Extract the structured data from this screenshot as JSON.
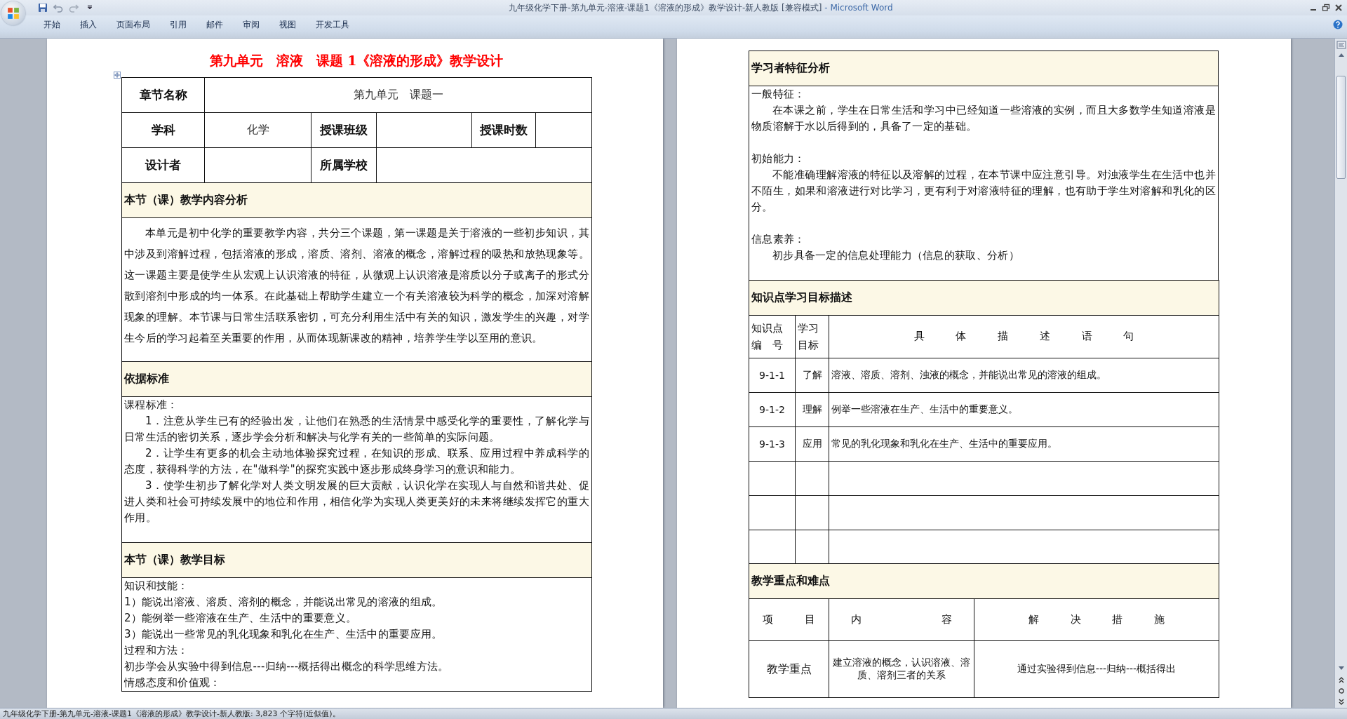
{
  "window": {
    "title": "九年级化学下册-第九单元-溶液-课题1《溶液的形成》教学设计-新人教版 [兼容模式]",
    "separator": "-",
    "app": "Microsoft Word"
  },
  "ribbon_tabs": [
    {
      "label": "开始",
      "selected": false
    },
    {
      "label": "插入",
      "selected": false
    },
    {
      "label": "页面布局",
      "selected": false
    },
    {
      "label": "引用",
      "selected": false
    },
    {
      "label": "邮件",
      "selected": false
    },
    {
      "label": "审阅",
      "selected": false
    },
    {
      "label": "视图",
      "selected": false
    },
    {
      "label": "开发工具",
      "selected": false
    }
  ],
  "left_page": {
    "heading": "第九单元　溶液　课题 1《溶液的形成》教学设计",
    "info": {
      "chapter_label": "章节名称",
      "chapter_value": "第九单元　课题一",
      "subject_label": "学科",
      "subject_value": "化学",
      "class_label": "授课班级",
      "hours_label": "授课时数",
      "designer_label": "设计者",
      "school_label": "所属学校"
    },
    "sections": [
      {
        "kind": "text",
        "title": "本节（课）教学内容分析",
        "paragraphs": [
          {
            "text": "本单元是初中化学的重要教学内容，共分三个课题，第一课题是关于溶液的一些初步知识，其中涉及到溶解过程，包括溶液的形成，溶质、溶剂、溶液的概念，溶解过程的吸热和放热现象等。这一课题主要是使学生从宏观上认识溶液的特征，从微观上认识溶液是溶质以分子或离子的形式分散到溶剂中形成的均一体系。在此基础上帮助学生建立一个有关溶液较为科学的概念，加深对溶解现象的理解。本节课与日常生活联系密切，可充分利用生活中有关的知识，激发学生的兴趣，对学生今后的学习起着至关重要的作用，从而体现新课改的精神，培养学生学以至用的意识。",
            "indent": true,
            "gap_after": true
          }
        ]
      },
      {
        "kind": "text",
        "title": "依据标准",
        "paragraphs": [
          {
            "text": "课程标准：",
            "indent": false,
            "gap_after": false
          },
          {
            "text": "1．注意从学生已有的经验出发，让他们在熟悉的生活情景中感受化学的重要性，了解化学与日常生活的密切关系，逐步学会分析和解决与化学有关的一些简单的实际问题。",
            "indent": true,
            "gap_after": false
          },
          {
            "text": "2．让学生有更多的机会主动地体验探究过程，在知识的形成、联系、应用过程中养成科学的态度，获得科学的方法，在\"做科学\"的探究实践中逐步形成终身学习的意识和能力。",
            "indent": true,
            "gap_after": false
          },
          {
            "text": "3．使学生初步了解化学对人类文明发展的巨大贡献，认识化学在实现人与自然和谐共处、促进人类和社会可持续发展中的地位和作用，相信化学为实现人类更美好的未来将继续发挥它的重大作用。",
            "indent": true,
            "gap_after": true
          }
        ]
      },
      {
        "kind": "text",
        "title": "本节（课）教学目标",
        "paragraphs": [
          {
            "text": "知识和技能：",
            "indent": false,
            "gap_after": false
          },
          {
            "text": "1）能说出溶液、溶质、溶剂的概念，并能说出常见的溶液的组成。",
            "indent": false,
            "gap_after": false
          },
          {
            "text": "2）能例举一些溶液在生产、生活中的重要意义。",
            "indent": false,
            "gap_after": false
          },
          {
            "text": "3）能说出一些常见的乳化现象和乳化在生产、生活中的重要应用。",
            "indent": false,
            "gap_after": false
          },
          {
            "text": "过程和方法：",
            "indent": false,
            "gap_after": false
          },
          {
            "text": "初步学会从实验中得到信息---归纳---概括得出概念的科学思维方法。",
            "indent": false,
            "gap_after": false
          },
          {
            "text": "情感态度和价值观：",
            "indent": false,
            "gap_after": false
          }
        ]
      }
    ]
  },
  "right_page": {
    "sections": [
      {
        "kind": "text",
        "title": "学习者特征分析",
        "paragraphs": [
          {
            "text": "一般特征：",
            "indent": false,
            "gap_after": false
          },
          {
            "text": "在本课之前，学生在日常生活和学习中已经知道一些溶液的实例，而且大多数学生知道溶液是物质溶解于水以后得到的，具备了一定的基础。",
            "indent": true,
            "gap_after": true
          },
          {
            "text": "初始能力：",
            "indent": false,
            "gap_after": false
          },
          {
            "text": "不能准确理解溶液的特征以及溶解的过程，在本节课中应注意引导。对浊液学生在生活中也并不陌生，如果和溶液进行对比学习，更有利于对溶液特征的理解，也有助于学生对溶解和乳化的区分。",
            "indent": true,
            "gap_after": true
          },
          {
            "text": "信息素养：",
            "indent": false,
            "gap_after": false
          },
          {
            "text": "初步具备一定的信息处理能力（信息的获取、分析）",
            "indent": true,
            "gap_after": true
          }
        ]
      },
      {
        "kind": "objectives",
        "title": "知识点学习目标描述",
        "columns": [
          [
            "知识点",
            "编　号"
          ],
          [
            "学习",
            "目标"
          ],
          [
            "具 体 描 述 语 句"
          ]
        ],
        "rows": [
          {
            "code": "9-1-1",
            "level": "了解",
            "description": "溶液、溶质、溶剂、浊液的概念，并能说出常见的溶液的组成。"
          },
          {
            "code": "9-1-2",
            "level": "理解",
            "description": "例举一些溶液在生产、生活中的重要意义。"
          },
          {
            "code": "9-1-3",
            "level": "应用",
            "description": "常见的乳化现象和乳化在生产、生活中的重要应用。"
          },
          {},
          {},
          {}
        ]
      },
      {
        "kind": "keypoints",
        "title": "教学重点和难点",
        "columns": [
          "项 目",
          "内 容",
          "解 决 措 施"
        ],
        "rows": [
          {
            "item": "教学重点",
            "content": "建立溶液的概念，认识溶液、溶质、溶剂三者的关系",
            "measure": "通过实验得到信息---归纳---概括得出"
          }
        ]
      }
    ]
  },
  "status_bar": {
    "text": "九年级化学下册-第九单元-溶液-课题1《溶液的形成》教学设计-新人教版: 3,823 个字符(近似值)。"
  }
}
